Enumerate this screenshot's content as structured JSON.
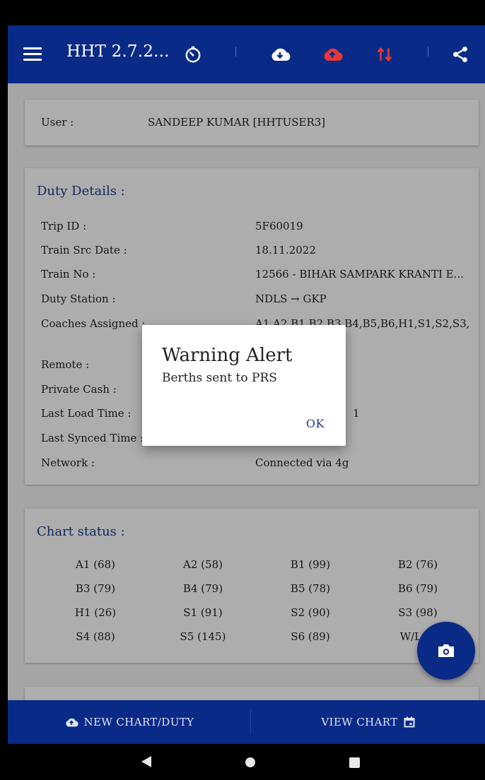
{
  "app": {
    "title": "HHT 2.7.2...",
    "accent_color": "#0a2a88",
    "alert_color": "#e53935",
    "icons": [
      "menu-icon",
      "timer-icon",
      "cloud-download-icon",
      "cloud-upload-icon",
      "sync-icon",
      "share-icon"
    ]
  },
  "user": {
    "label": "User :",
    "value": "SANDEEP KUMAR [HHTUSER3]"
  },
  "duty": {
    "title": "Duty Details :",
    "rows": [
      {
        "label": "Trip ID :",
        "value": "5F60019"
      },
      {
        "label": "Train Src Date :",
        "value": "18.11.2022"
      },
      {
        "label": "Train No :",
        "value": "12566 - BIHAR SAMPARK KRANTI E..."
      },
      {
        "label": "Duty Station :",
        "value": "NDLS → GKP"
      },
      {
        "label": "Coaches Assigned :",
        "value": "A1,A2,B1,B2,B3,B4,B5,B6,H1,S1,S2,S3,"
      },
      {
        "label": "Remote :",
        "value": ""
      },
      {
        "label": "Private Cash :",
        "value": ""
      },
      {
        "label": "Last Load Time :",
        "value": "1"
      },
      {
        "label": "Last Synced Time :",
        "value": ""
      },
      {
        "label": "Network :",
        "value": "Connected via 4g"
      }
    ]
  },
  "chart_status": {
    "title": "Chart status :",
    "cells": [
      "A1 (68)",
      "A2 (58)",
      "B1 (99)",
      "B2 (76)",
      "B3 (79)",
      "B4 (79)",
      "B5 (78)",
      "B6 (79)",
      "H1 (26)",
      "S1 (91)",
      "S2 (90)",
      "S3 (98)",
      "S4 (88)",
      "S5 (145)",
      "S6 (89)",
      "W/L (4"
    ]
  },
  "dialog": {
    "title": "Warning Alert",
    "message": "Berths sent to PRS",
    "ok_label": "OK"
  },
  "bottom_bar": {
    "new_chart_label": "NEW CHART/DUTY",
    "view_chart_label": "VIEW CHART"
  }
}
